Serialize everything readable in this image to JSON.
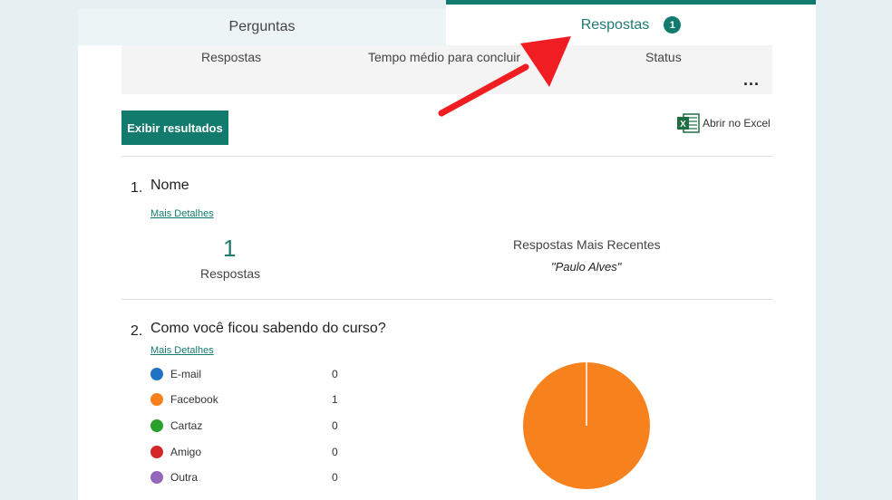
{
  "tabs": [
    {
      "label": "Perguntas"
    },
    {
      "label": "Respostas",
      "badge": "1"
    }
  ],
  "summary": {
    "col1": "Respostas",
    "col2": "Tempo médio para concluir",
    "col3": "Status",
    "more": "..."
  },
  "toolbar": {
    "results_label": "Exibir resultados",
    "excel_label": "Abrir no Excel"
  },
  "questions": [
    {
      "number": "1.",
      "title": "Nome",
      "details": "Mais Detalhes",
      "count": "1",
      "count_label": "Respostas",
      "recent_label": "Respostas Mais Recentes",
      "recent_value": "\"Paulo Alves\""
    },
    {
      "number": "2.",
      "title": "Como você ficou sabendo do curso?",
      "details": "Mais Detalhes",
      "options": [
        {
          "label": "E-mail",
          "count": "0",
          "color": "#1f73c4"
        },
        {
          "label": "Facebook",
          "count": "1",
          "color": "#f7821d"
        },
        {
          "label": "Cartaz",
          "count": "0",
          "color": "#2ca02c"
        },
        {
          "label": "Amigo",
          "count": "0",
          "color": "#d62728"
        },
        {
          "label": "Outra",
          "count": "0",
          "color": "#9467bd"
        }
      ]
    }
  ],
  "colors": {
    "accent": "#137a6e",
    "annotation_arrow": "#f01e23"
  }
}
